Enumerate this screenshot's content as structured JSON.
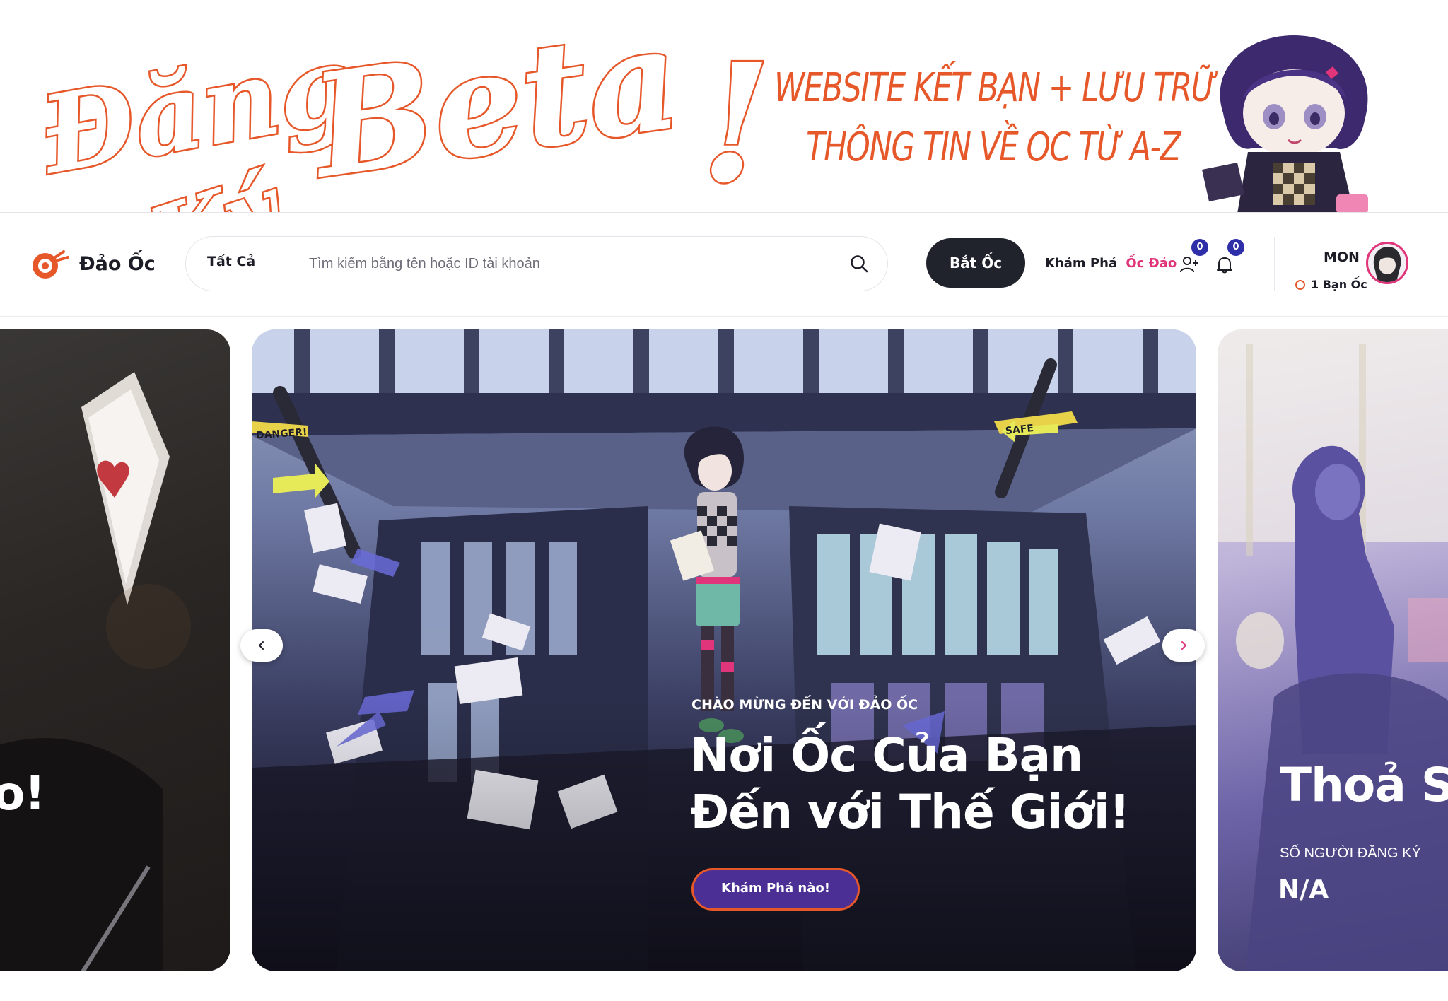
{
  "banner": {
    "script_line1": "Đăng",
    "script_line2": "Ký",
    "script_word": "Beta",
    "script_exclaim": "!",
    "tagline_line1": "WEBSITE KẾT BẠN + LƯU TRỮ",
    "tagline_line2": "THÔNG TIN VỀ OC TỪ A-Z"
  },
  "header": {
    "logo_text": "Đảo Ốc",
    "search": {
      "category": "Tất Cả",
      "placeholder": "Tìm kiếm bằng tên hoặc ID tài khoản",
      "value": ""
    },
    "primary_button": "Bắt Ốc",
    "explore_prefix": "Khám Phá",
    "explore_highlight": "Ốc Đảo",
    "friend_requests_count": "0",
    "notifications_count": "0",
    "user": {
      "name": "MON",
      "subtitle": "1 Bạn Ốc"
    }
  },
  "carousel": {
    "left_slide": {
      "title_fragment": "o!"
    },
    "center_slide": {
      "kicker": "CHÀO MỪNG ĐẾN VỚI ĐẢO ỐC",
      "title_line1": "Nơi Ốc Của Bạn",
      "title_line2": "Đến với Thế Giới!",
      "cta": "Khám Phá nào!",
      "scene_signs": [
        "DANGER!",
        "SAFE"
      ]
    },
    "right_slide": {
      "title_fragment": "Thoả S",
      "stat_label": "SỐ NGƯỜI ĐĂNG KÝ",
      "stat_value": "N/A"
    }
  },
  "colors": {
    "brand_orange": "#e6582a",
    "dark_button": "#20222c",
    "cta_purple": "#4b2f94",
    "badge_blue": "#2e2ea8",
    "accent_pink": "#e0357a"
  },
  "icons": [
    "snail-logo-icon",
    "search-icon",
    "add-friend-icon",
    "bell-icon",
    "chevron-left-icon",
    "chevron-right-icon"
  ]
}
